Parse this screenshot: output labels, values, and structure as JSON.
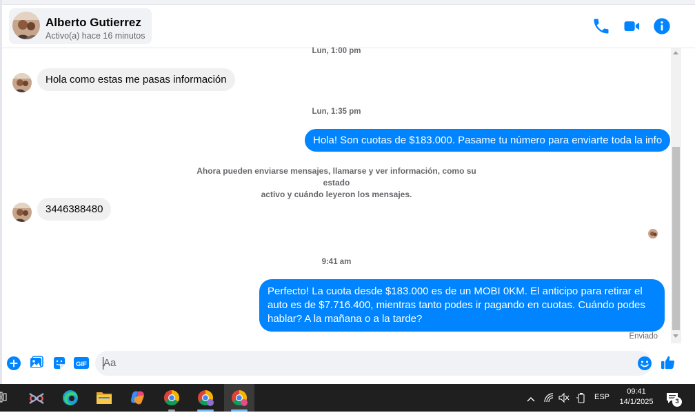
{
  "header": {
    "contact_name": "Alberto Gutierrez",
    "contact_status": "Activo(a) hace 16 minutos"
  },
  "messages": {
    "ts1": "Lun, 1:00 pm",
    "msg1": "Hola como estas me pasas información",
    "ts2": "Lun, 1:35 pm",
    "msg2": "Hola! Son cuotas de $183.000. Pasame tu número para enviarte toda la info",
    "system_line1": "Ahora pueden enviarse mensajes, llamarse y ver información, como su estado",
    "system_line2": "activo y cuándo leyeron los mensajes.",
    "msg3": "3446388480",
    "ts3": "9:41 am",
    "msg4": "Perfecto! La cuota desde $183.000 es de un MOBI 0KM. El anticipo para retirar el auto es de $7.716.400, mientras tanto podes ir pagando en cuotas. Cuándo podes hablar? A la mañana o a la tarde?",
    "sent_status": "Enviado"
  },
  "composer": {
    "placeholder": "Aa"
  },
  "taskbar": {
    "language": "ESP",
    "time": "09:41",
    "date": "14/1/2025",
    "notification_count": "3"
  },
  "colors": {
    "accent": "#0084ff",
    "incoming_bubble": "#f0f0f0",
    "taskbar": "#1f1f1f"
  },
  "icons": [
    "phone-icon",
    "video-icon",
    "info-icon",
    "plus-icon",
    "image-icon",
    "sticker-icon",
    "gif-icon",
    "emoji-icon",
    "like-icon"
  ]
}
